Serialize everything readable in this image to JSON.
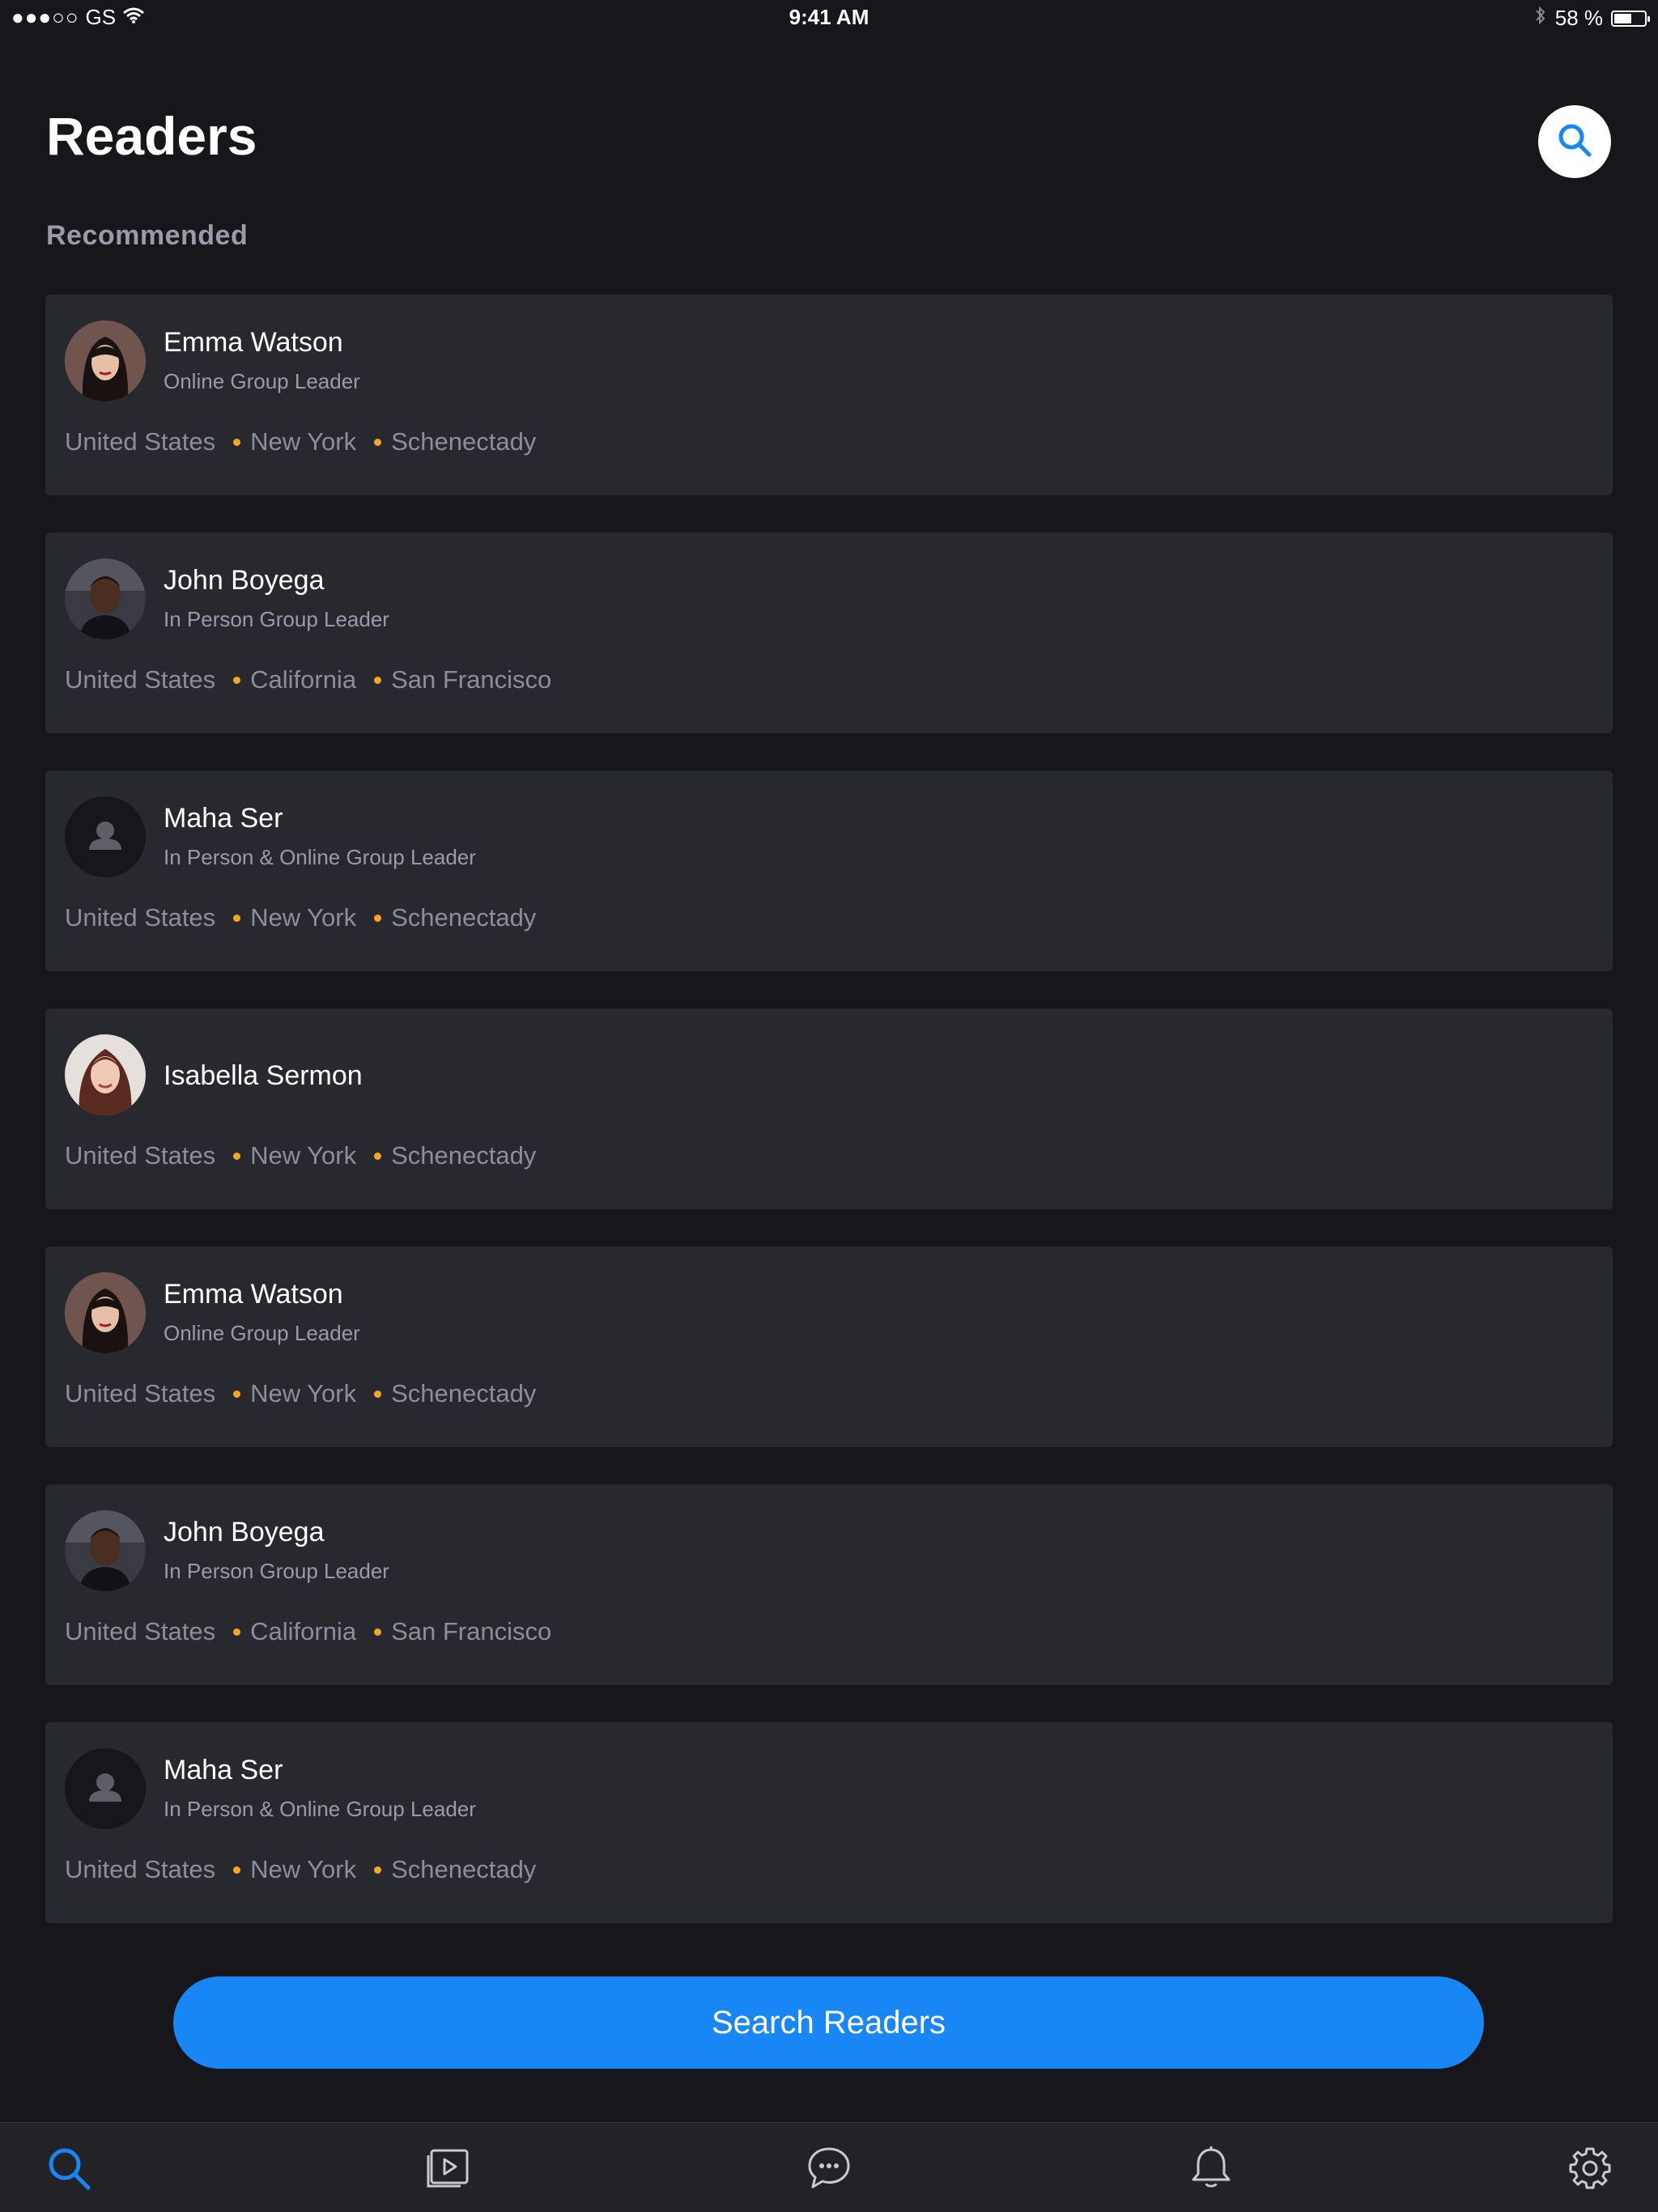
{
  "status_bar": {
    "signal_dots": "●●●○○",
    "carrier": "GS",
    "time": "9:41 AM",
    "battery_percent": "58 %",
    "battery_level": 0.58
  },
  "header": {
    "title": "Readers",
    "search_icon": "search-icon"
  },
  "section": {
    "title": "Recommended"
  },
  "readers": [
    {
      "name": "Emma Watson",
      "role": "Online Group Leader",
      "country": "United States",
      "state": "New York",
      "city": "Schenectady",
      "avatar": "photo-woman"
    },
    {
      "name": "John Boyega",
      "role": "In Person  Group Leader",
      "country": "United States",
      "state": "California",
      "city": "San Francisco",
      "avatar": "photo-man"
    },
    {
      "name": "Maha Ser",
      "role": "In Person & Online Group Leader",
      "country": "United States",
      "state": "New York",
      "city": "Schenectady",
      "avatar": "placeholder"
    },
    {
      "name": "Isabella Sermon",
      "role": "",
      "country": "United States",
      "state": "New York",
      "city": "Schenectady",
      "avatar": "photo-woman-2"
    },
    {
      "name": "Emma Watson",
      "role": "Online Group Leader",
      "country": "United States",
      "state": "New York",
      "city": "Schenectady",
      "avatar": "photo-woman"
    },
    {
      "name": "John Boyega",
      "role": "In Person  Group Leader",
      "country": "United States",
      "state": "California",
      "city": "San Francisco",
      "avatar": "photo-man"
    },
    {
      "name": "Maha Ser",
      "role": "In Person & Online Group Leader",
      "country": "United States",
      "state": "New York",
      "city": "Schenectady",
      "avatar": "placeholder"
    }
  ],
  "cta": {
    "label": "Search Readers"
  },
  "tabs": [
    "search-icon",
    "video-library-icon",
    "chat-icon",
    "bell-icon",
    "gear-icon"
  ],
  "colors": {
    "background": "#16161b",
    "card": "#28282f",
    "accent": "#1886f4",
    "separator_dot": "#f5a623",
    "muted_text": "#9a9ba6"
  }
}
